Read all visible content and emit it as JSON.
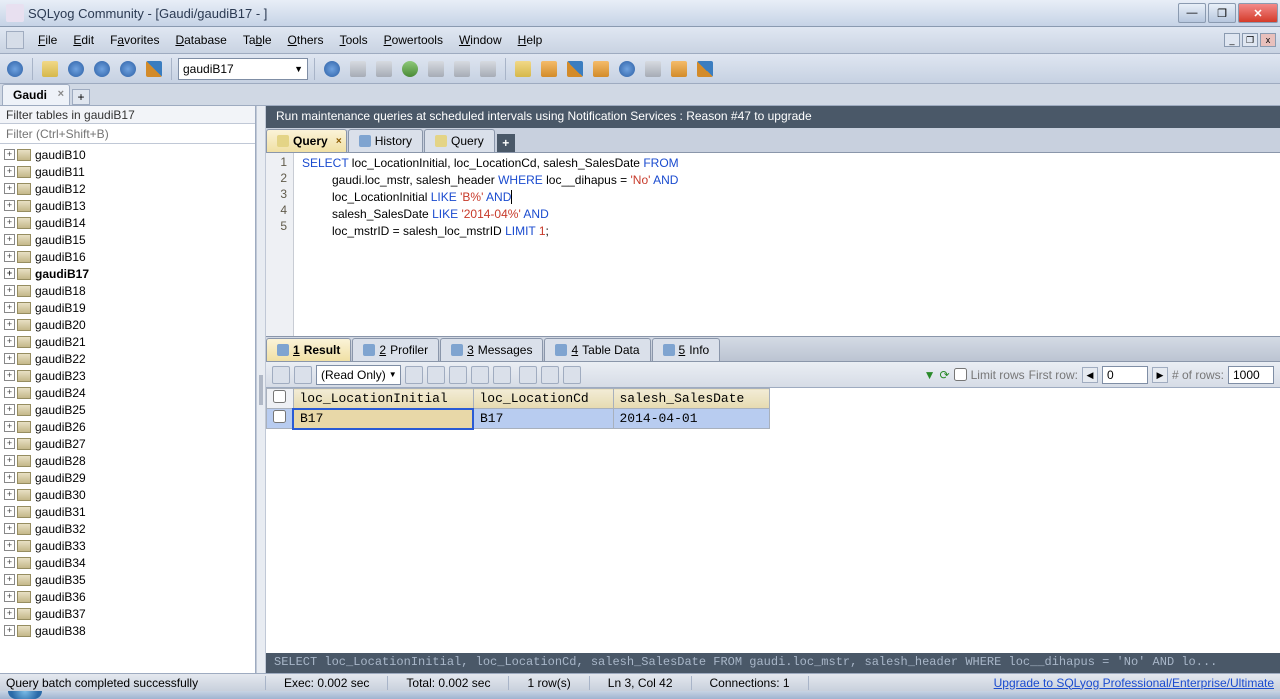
{
  "title": "SQLyog Community - [Gaudi/gaudiB17 -                                     ]",
  "menu": [
    "File",
    "Edit",
    "Favorites",
    "Database",
    "Table",
    "Others",
    "Tools",
    "Powertools",
    "Window",
    "Help"
  ],
  "db_select": "gaudiB17",
  "conn_tab": "Gaudi",
  "sidebar": {
    "filter_label": "Filter tables in gaudiB17",
    "filter_placeholder": "Filter (Ctrl+Shift+B)",
    "items": [
      "gaudiB10",
      "gaudiB11",
      "gaudiB12",
      "gaudiB13",
      "gaudiB14",
      "gaudiB15",
      "gaudiB16",
      "gaudiB17",
      "gaudiB18",
      "gaudiB19",
      "gaudiB20",
      "gaudiB21",
      "gaudiB22",
      "gaudiB23",
      "gaudiB24",
      "gaudiB25",
      "gaudiB26",
      "gaudiB27",
      "gaudiB28",
      "gaudiB29",
      "gaudiB30",
      "gaudiB31",
      "gaudiB32",
      "gaudiB33",
      "gaudiB34",
      "gaudiB35",
      "gaudiB36",
      "gaudiB37",
      "gaudiB38"
    ],
    "selected": "gaudiB17"
  },
  "promo": "Run maintenance queries at scheduled intervals using Notification Services : Reason #47 to upgrade",
  "qtabs": {
    "active": "Query",
    "items": [
      "Query",
      "History",
      "Query"
    ]
  },
  "editor": {
    "lines": [
      1,
      2,
      3,
      4,
      5
    ],
    "l1a": "SELECT",
    "l1b": " loc_LocationInitial, loc_LocationCd, salesh_SalesDate ",
    "l1c": "FROM",
    "l2a": "         gaudi.loc_mstr, salesh_header ",
    "l2b": "WHERE",
    "l2c": " loc__dihapus = ",
    "l2d": "'No'",
    "l2e": " ",
    "l2f": "AND",
    "l3a": "         loc_LocationInitial ",
    "l3b": "LIKE",
    "l3c": " ",
    "l3d": "'B%'",
    "l3e": " ",
    "l3f": "AND",
    "l4a": "         salesh_SalesDate ",
    "l4b": "LIKE",
    "l4c": " ",
    "l4d": "'2014-04%'",
    "l4e": " ",
    "l4f": "AND",
    "l5a": "         loc_mstrID = salesh_loc_mstrID ",
    "l5b": "LIMIT",
    "l5c": " ",
    "l5d": "1",
    "l5e": ";"
  },
  "rtabs": [
    {
      "n": "1",
      "u": "1",
      "label": "Result"
    },
    {
      "n": "2",
      "u": "2",
      "label": "Profiler"
    },
    {
      "n": "3",
      "u": "3",
      "label": "Messages"
    },
    {
      "n": "4",
      "u": "4",
      "label": "Table Data"
    },
    {
      "n": "5",
      "u": "5",
      "label": "Info"
    }
  ],
  "rtoolbar": {
    "mode": "(Read Only)",
    "limit_label": "Limit rows",
    "first_label": "First row:",
    "first_val": "0",
    "rows_label": "# of rows:",
    "rows_val": "1000"
  },
  "grid": {
    "cols": [
      "loc_LocationInitial",
      "loc_LocationCd",
      "salesh_SalesDate"
    ],
    "row": [
      "B17",
      "B17",
      "2014-04-01"
    ]
  },
  "bottom_sql": "SELECT loc_LocationInitial, loc_LocationCd, salesh_SalesDate FROM gaudi.loc_mstr, salesh_header WHERE loc__dihapus = 'No' AND lo...",
  "status": {
    "msg": "Query batch completed successfully",
    "exec": "Exec: 0.002 sec",
    "total": "Total: 0.002 sec",
    "rows": "1 row(s)",
    "pos": "Ln 3, Col 42",
    "conn": "Connections: 1",
    "link": "Upgrade to SQLyog Professional/Enterprise/Ultimate"
  }
}
